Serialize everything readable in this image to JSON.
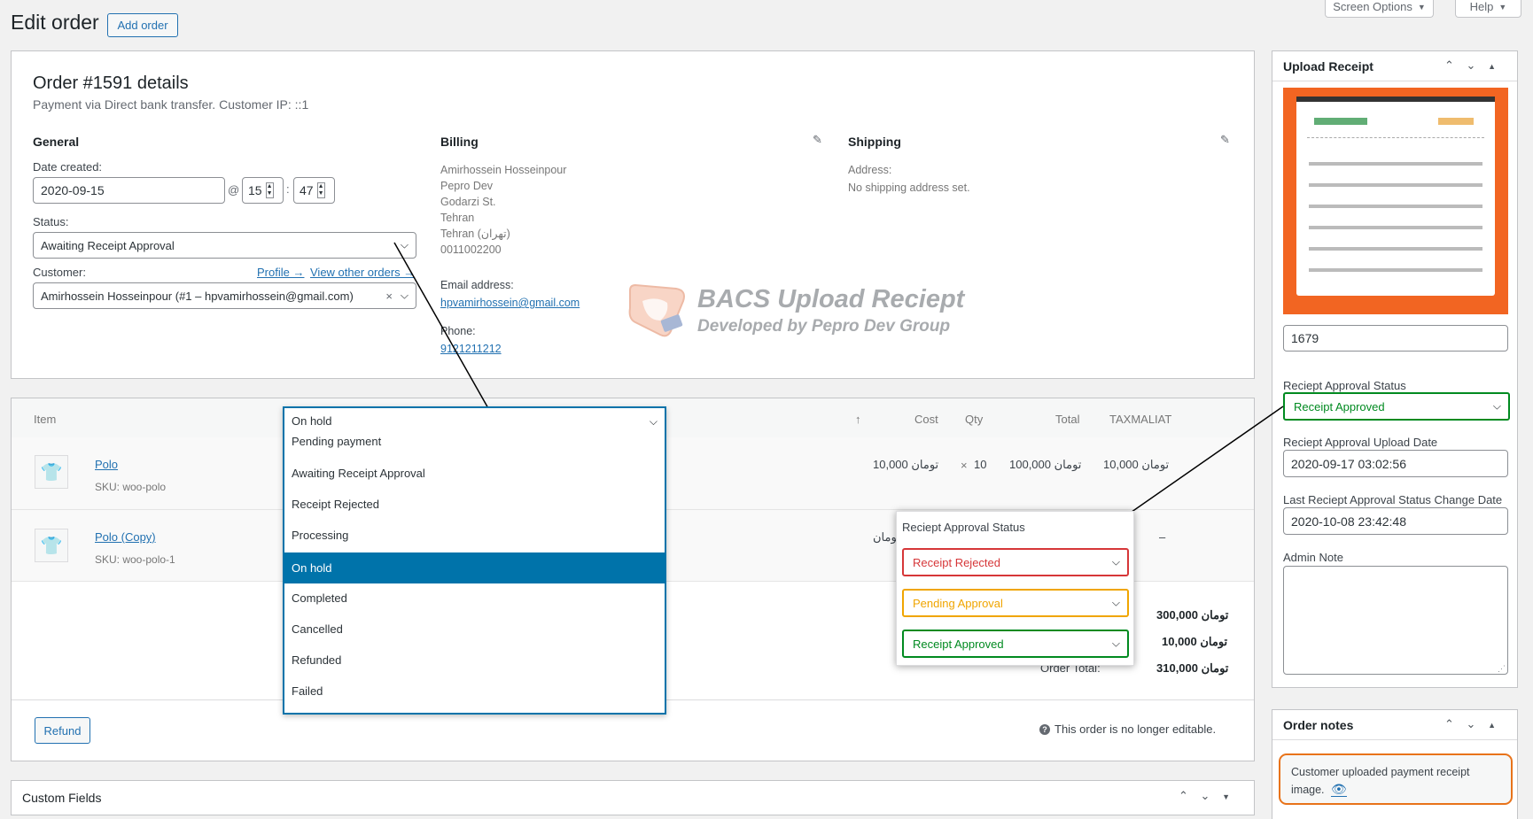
{
  "header": {
    "title": "Edit order",
    "add_order": "Add order",
    "screen_options": "Screen Options",
    "help": "Help"
  },
  "order": {
    "title": "Order #1591 details",
    "subtitle": "Payment via Direct bank transfer. Customer IP: ::1",
    "general": {
      "heading": "General",
      "date_label": "Date created:",
      "date": "2020-09-15",
      "at": "@",
      "hour": "15",
      "colon": ":",
      "minute": "47",
      "status_label": "Status:",
      "status": "Awaiting Receipt Approval",
      "customer_label": "Customer:",
      "profile_link": "Profile →",
      "other_orders_link": "View other orders →",
      "customer": "Amirhossein Hosseinpour (#1 – hpvamirhossein@gmail.com)",
      "clear": "×"
    },
    "billing": {
      "heading": "Billing",
      "lines": [
        "Amirhossein Hosseinpour",
        "Pepro Dev",
        "Godarzi St.",
        "Tehran",
        "Tehran (تهران)",
        "0011002200"
      ],
      "email_label": "Email address:",
      "email": "hpvamirhossein@gmail.com",
      "phone_label": "Phone:",
      "phone": "9121211212"
    },
    "shipping": {
      "heading": "Shipping",
      "address_label": "Address:",
      "address": "No shipping address set."
    }
  },
  "watermark": {
    "title": "BACS Upload Reciept",
    "subtitle": "Developed by Pepro Dev Group"
  },
  "items": {
    "headers": {
      "item": "Item",
      "sort": "↑",
      "cost": "Cost",
      "qty": "Qty",
      "total": "Total",
      "tax": "TAXMALIAT"
    },
    "rows": [
      {
        "name": "Polo",
        "sku": "SKU: woo-polo",
        "cost": "10,000 تومان",
        "x": "×",
        "qty": "10",
        "total": "100,000 تومان",
        "tax": "10,000 تومان"
      },
      {
        "name": "Polo (Copy)",
        "sku": "SKU: woo-polo-1",
        "cost": "تومان",
        "tax": "–"
      }
    ],
    "totals": {
      "items_subtotal": "300,000 تومان",
      "tax": "10,000 تومان",
      "order_total_label": "Order Total:",
      "order_total": "310,000 تومان"
    },
    "refund": "Refund",
    "not_editable": "This order is no longer editable.",
    "help_icon": "?"
  },
  "status_dropdown": {
    "selected": "On hold",
    "options": [
      "Pending payment",
      "Awaiting Receipt Approval",
      "Receipt Rejected",
      "Processing",
      "On hold",
      "Completed",
      "Cancelled",
      "Refunded",
      "Failed"
    ]
  },
  "approval_popup": {
    "title": "Reciept Approval Status",
    "options": [
      {
        "label": "Receipt Rejected",
        "color": "#d63638"
      },
      {
        "label": "Pending Approval",
        "color": "#f0a500"
      },
      {
        "label": "Receipt Approved",
        "color": "#008a20"
      }
    ]
  },
  "custom_fields": {
    "title": "Custom Fields"
  },
  "sidebar": {
    "upload_receipt": {
      "title": "Upload Receipt",
      "attachment_id": "1679",
      "status_label": "Reciept Approval Status",
      "status": "Receipt Approved",
      "status_color": "#008a20",
      "upload_date_label": "Reciept Approval Upload Date",
      "upload_date": "2020-09-17 03:02:56",
      "change_date_label": "Last Reciept Approval Status Change Date",
      "change_date": "2020-10-08 23:42:48",
      "admin_note_label": "Admin Note",
      "admin_note": ""
    },
    "order_notes": {
      "title": "Order notes",
      "note": "Customer uploaded payment receipt image."
    }
  },
  "colors": {
    "accent": "#2271b1",
    "selected": "#0073aa",
    "note_border": "#e8731a",
    "receipt_bg": "#f26522"
  }
}
